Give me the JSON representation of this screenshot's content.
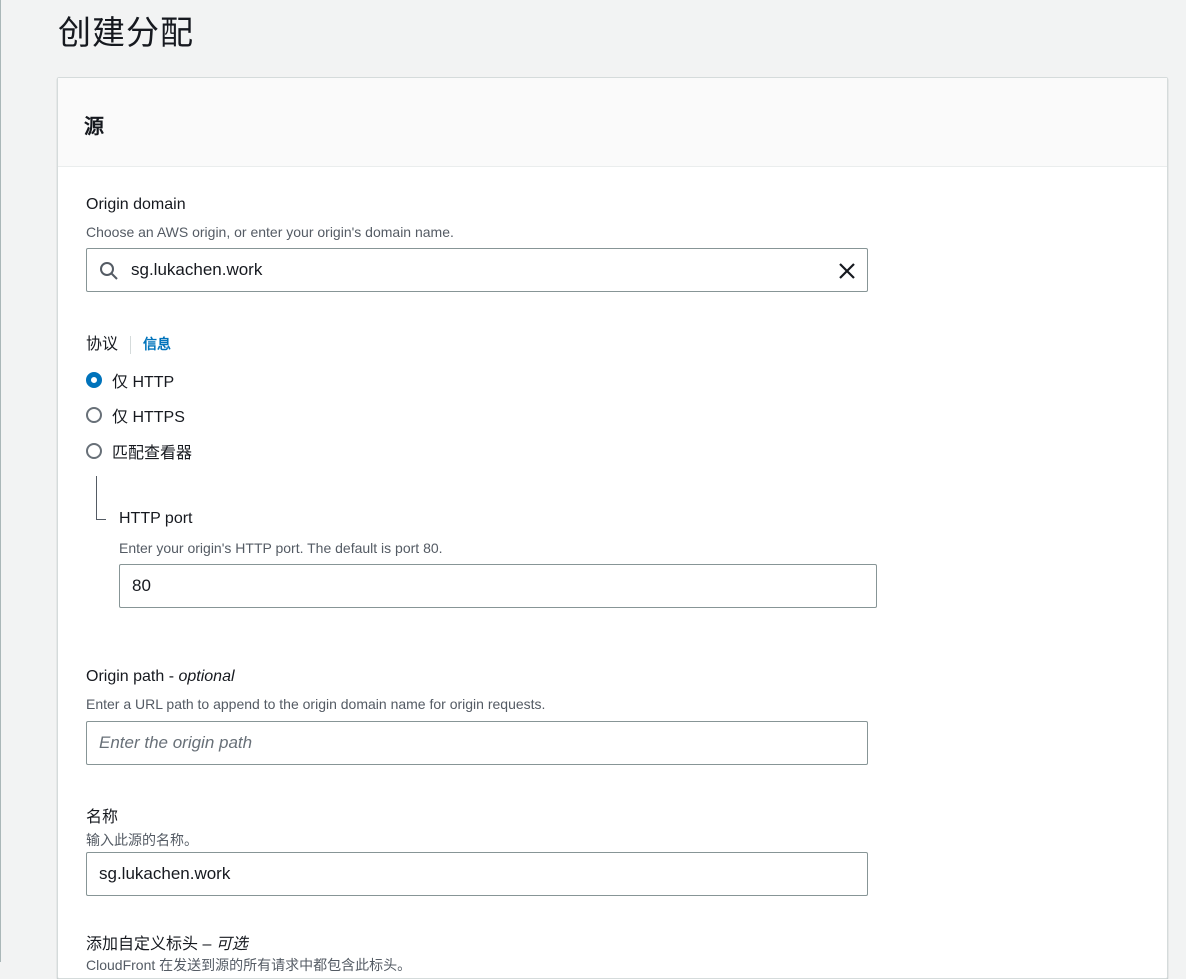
{
  "page": {
    "title": "创建分配"
  },
  "panel": {
    "title": "源"
  },
  "origin_domain": {
    "label": "Origin domain",
    "description": "Choose an AWS origin, or enter your origin's domain name.",
    "value": "sg.lukachen.work"
  },
  "protocol": {
    "label": "协议",
    "info_link": "信息",
    "options": [
      {
        "label": "仅 HTTP",
        "checked": true
      },
      {
        "label": "仅 HTTPS",
        "checked": false
      },
      {
        "label": "匹配查看器",
        "checked": false
      }
    ]
  },
  "http_port": {
    "label": "HTTP port",
    "description": "Enter your origin's HTTP port. The default is port 80.",
    "value": "80"
  },
  "origin_path": {
    "label": "Origin path - ",
    "label_optional": "optional",
    "description": "Enter a URL path to append to the origin domain name for origin requests.",
    "placeholder": "Enter the origin path"
  },
  "name": {
    "label": "名称",
    "description": "输入此源的名称。",
    "value": "sg.lukachen.work"
  },
  "custom_headers": {
    "label": "添加自定义标头 – ",
    "label_optional": "可选",
    "description": "CloudFront 在发送到源的所有请求中都包含此标头。"
  },
  "icons": {
    "search": "search-icon",
    "clear": "close-icon"
  },
  "colors": {
    "accent": "#0073bb",
    "page_bg": "#f2f3f3"
  }
}
